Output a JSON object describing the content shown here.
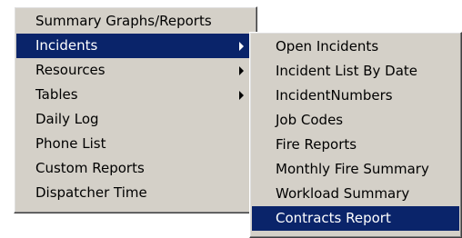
{
  "main_menu": {
    "items": [
      {
        "label": "Summary Graphs/Reports"
      },
      {
        "label": "Incidents"
      },
      {
        "label": "Resources"
      },
      {
        "label": "Tables"
      },
      {
        "label": "Daily Log"
      },
      {
        "label": "Phone List"
      },
      {
        "label": "Custom Reports"
      },
      {
        "label": "Dispatcher Time"
      }
    ],
    "highlighted": "Incidents"
  },
  "sub_menu": {
    "parent": "Incidents",
    "items": [
      {
        "label": "Open Incidents"
      },
      {
        "label": "Incident List By Date"
      },
      {
        "label": "IncidentNumbers"
      },
      {
        "label": "Job Codes"
      },
      {
        "label": "Fire Reports"
      },
      {
        "label": "Monthly Fire Summary"
      },
      {
        "label": "Workload Summary"
      },
      {
        "label": "Contracts Report"
      }
    ],
    "highlighted": "Contracts Report"
  },
  "colors": {
    "menu_background": "#d4d0c8",
    "highlight_background": "#0a246a",
    "highlight_text": "#ffffff"
  }
}
